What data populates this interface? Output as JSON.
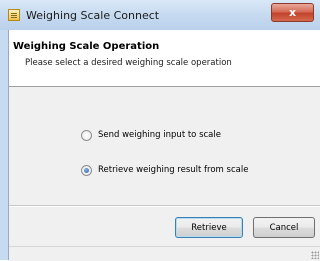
{
  "window": {
    "title": "Weighing Scale Connect",
    "close_label": "x"
  },
  "header": {
    "title": "Weighing Scale Operation",
    "subtitle": "Please select a desired weighing scale operation"
  },
  "options": [
    {
      "label": "Send weighing input to scale",
      "selected": false
    },
    {
      "label": "Retrieve weighing result from scale",
      "selected": true
    }
  ],
  "buttons": {
    "retrieve_label": "Retrieve",
    "cancel_label": "Cancel"
  },
  "icons": {
    "app": "scale-app-icon",
    "close": "close-icon",
    "resize": "resize-grip-icon"
  },
  "colors": {
    "titlebar": "#c5d9ef",
    "close_button": "#c2432c",
    "radio_selected": "#1b5aa8"
  }
}
